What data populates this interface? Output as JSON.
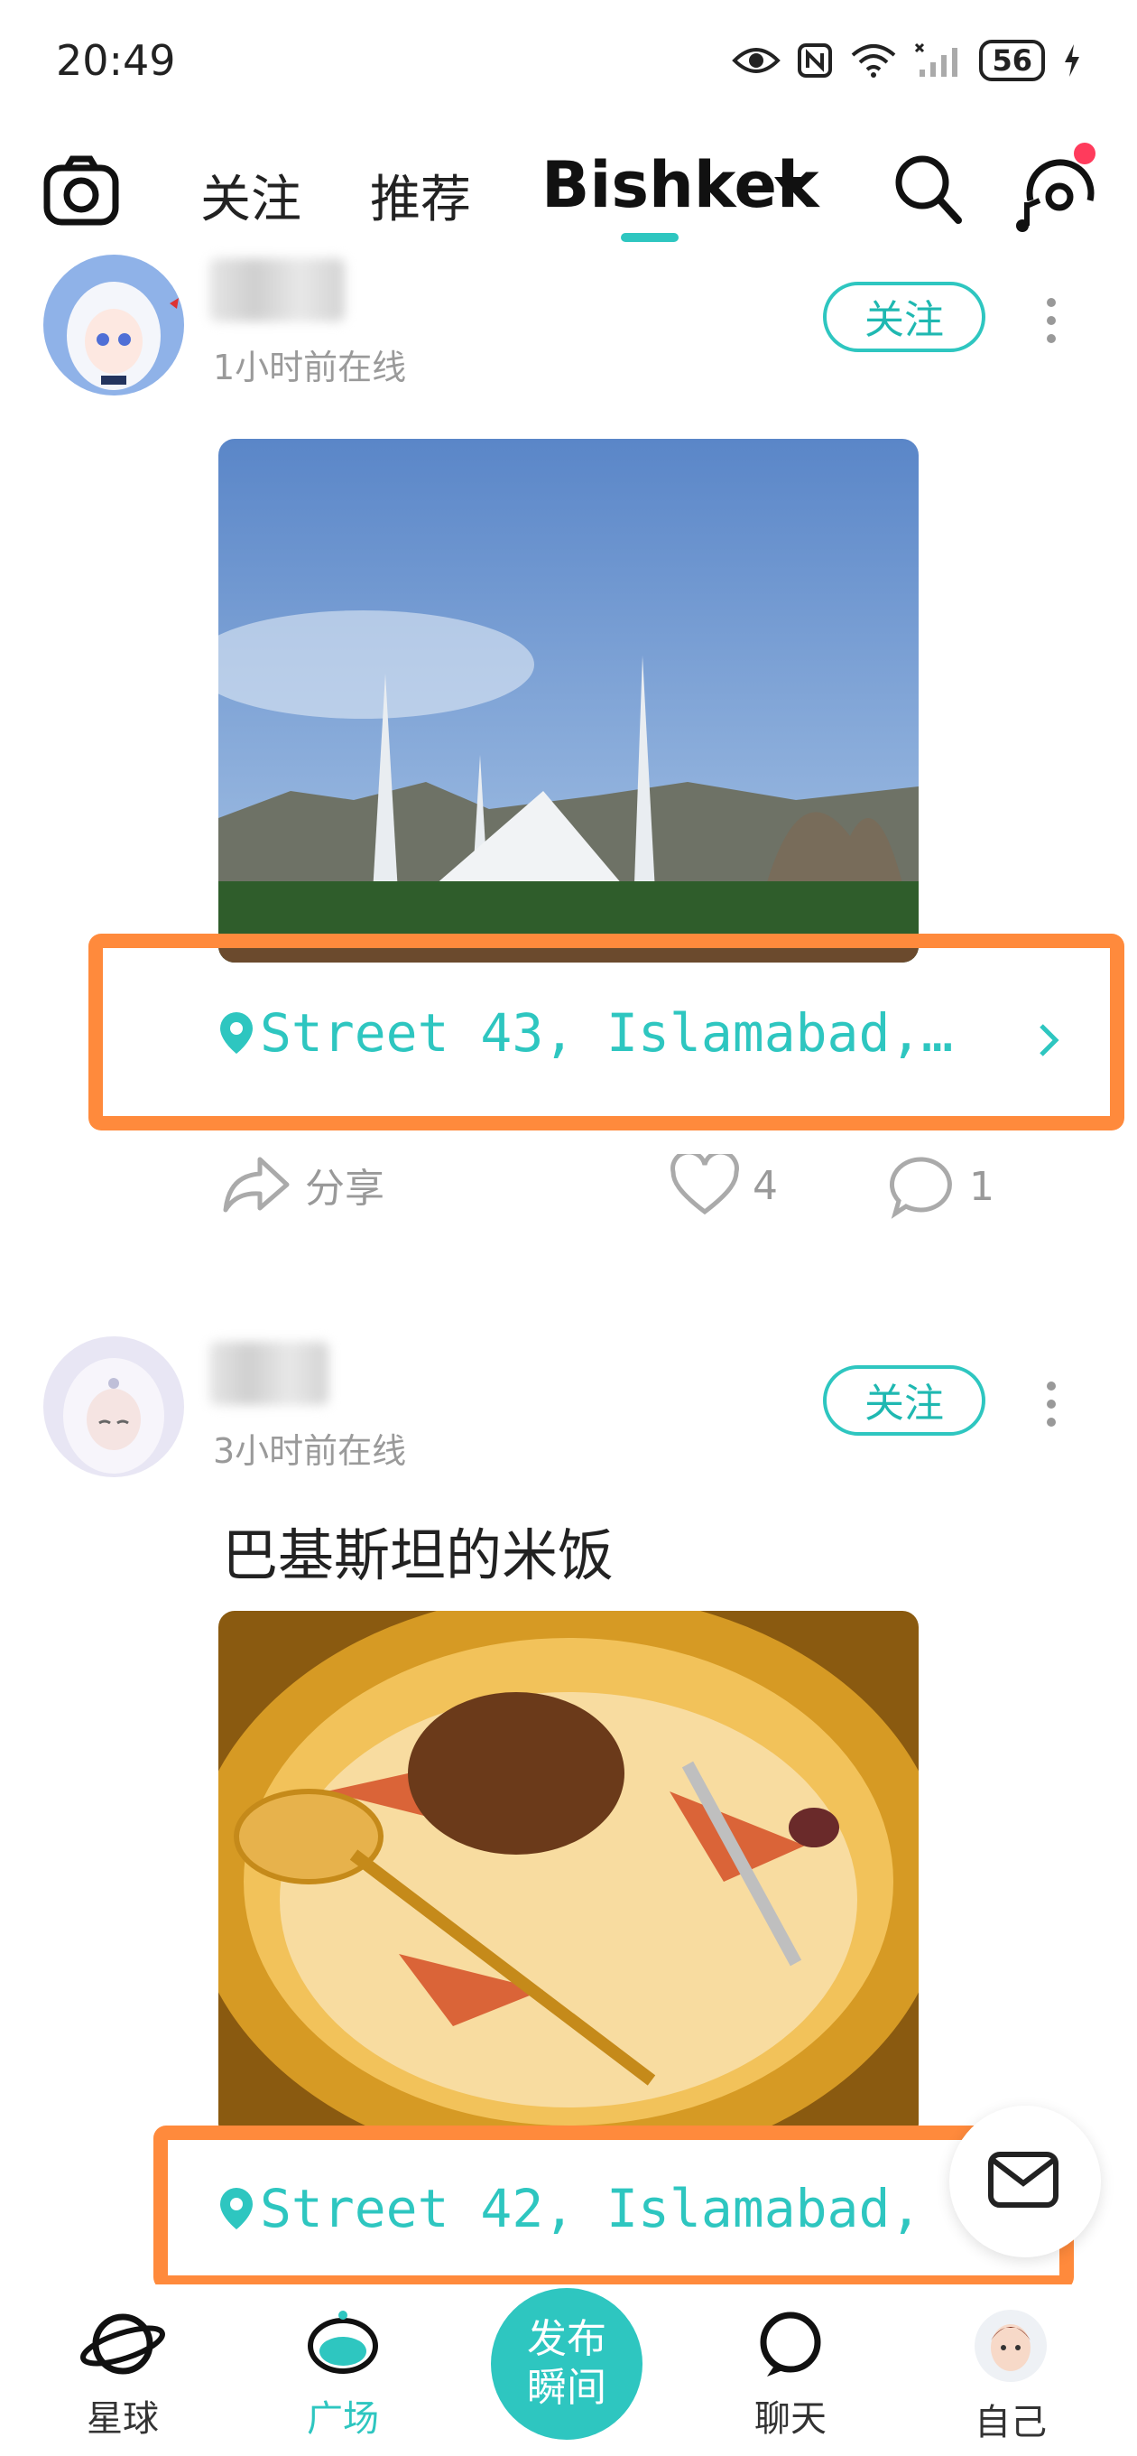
{
  "status_bar": {
    "time": "20:49",
    "battery": "56"
  },
  "top_nav": {
    "tabs": [
      "关注",
      "推荐"
    ],
    "city": "Bishkek"
  },
  "posts": [
    {
      "online_status": "1小时前在线",
      "follow_label": "关注",
      "caption": "",
      "location": "Street 43, Islamabad,…",
      "share_label": "分享",
      "likes": "4",
      "comments": "1"
    },
    {
      "online_status": "3小时前在线",
      "follow_label": "关注",
      "caption": "巴基斯坦的米饭",
      "location": "Street 42, Islamabad,"
    }
  ],
  "bottom_nav": {
    "items": [
      {
        "label": "星球",
        "icon": "planet-icon"
      },
      {
        "label": "广场",
        "icon": "square-icon"
      },
      {
        "label": "聊天",
        "icon": "chat-icon"
      },
      {
        "label": "自己",
        "icon": "profile-avatar"
      }
    ],
    "publish_label": "发布瞬间"
  },
  "colors": {
    "accent": "#2ec6c0",
    "highlight": "#ff8a3c",
    "badge": "#ff3b5c"
  }
}
